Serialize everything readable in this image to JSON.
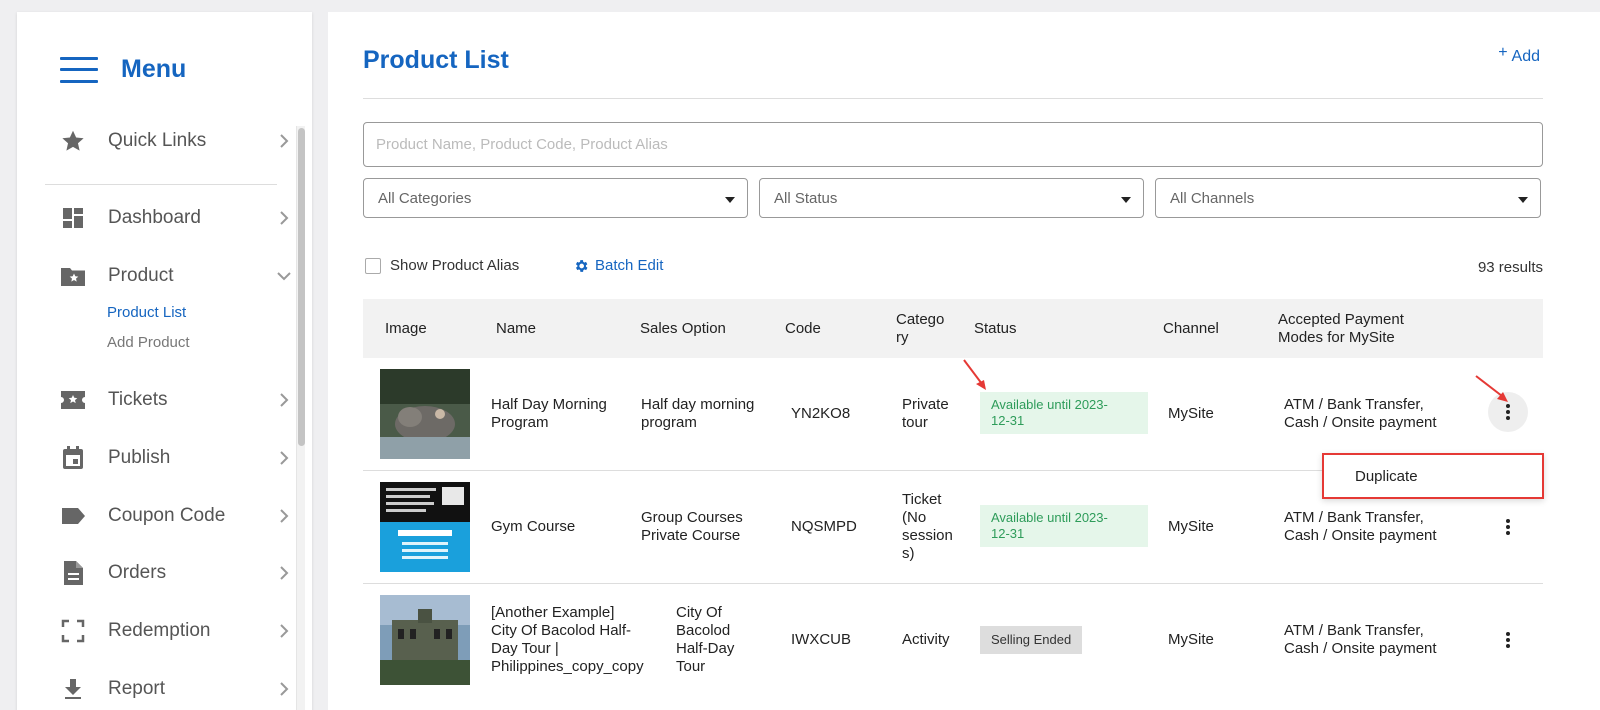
{
  "sidebar": {
    "menu_title": "Menu",
    "items": [
      {
        "label": "Quick Links",
        "icon": "star-icon"
      },
      {
        "label": "Dashboard",
        "icon": "dashboard-icon"
      },
      {
        "label": "Product",
        "icon": "folder-star-icon"
      },
      {
        "label": "Tickets",
        "icon": "ticket-icon"
      },
      {
        "label": "Publish",
        "icon": "calendar-icon"
      },
      {
        "label": "Coupon Code",
        "icon": "tag-icon"
      },
      {
        "label": "Orders",
        "icon": "document-icon"
      },
      {
        "label": "Redemption",
        "icon": "scan-icon"
      },
      {
        "label": "Report",
        "icon": "download-icon"
      }
    ],
    "product_submenu": [
      "Product List",
      "Add Product"
    ]
  },
  "header": {
    "title": "Product List",
    "add_label": "Add"
  },
  "filters": {
    "search_placeholder": "Product Name, Product Code, Product Alias",
    "categories": "All Categories",
    "status": "All Status",
    "channels": "All Channels"
  },
  "toolbar": {
    "show_alias_label": "Show Product Alias",
    "batch_edit_label": "Batch Edit",
    "results": "93 results"
  },
  "table": {
    "headers": {
      "image": "Image",
      "name": "Name",
      "sales_option": "Sales Option",
      "code": "Code",
      "category": "Catego\nry",
      "status": "Status",
      "channel": "Channel",
      "payment": "Accepted Payment\nModes for MySite"
    },
    "rows": [
      {
        "name": "Half Day Morning\nProgram",
        "sales_option": "Half day morning\nprogram",
        "code": "YN2KO8",
        "category": "Private\ntour",
        "status": "Available until 2023-\n12-31",
        "channel": "MySite",
        "payment": "ATM / Bank Transfer,\nCash / Onsite payment"
      },
      {
        "name": "Gym Course",
        "sales_option": "Group Courses\nPrivate Course",
        "code": "NQSMPD",
        "category": "Ticket\n(No\nsession\ns)",
        "status": "Available until 2023-\n12-31",
        "channel": "MySite",
        "payment": "ATM / Bank Transfer,\nCash / Onsite payment"
      },
      {
        "name": "[Another Example]\nCity Of Bacolod Half-\nDay Tour |\nPhilippines_copy_copy",
        "sales_option": "City Of\nBacolod\nHalf-Day\nTour",
        "code": "IWXCUB",
        "category": "Activity",
        "status": "Selling Ended",
        "channel": "MySite",
        "payment": "ATM / Bank Transfer,\nCash / Onsite payment"
      }
    ]
  },
  "context_menu": {
    "duplicate_label": "Duplicate"
  },
  "colors": {
    "accent": "#1565c0",
    "status_available_bg": "#e5f6ea",
    "status_available_text": "#2e9c5a",
    "status_ended_bg": "#dddddd",
    "highlight": "#e53935"
  }
}
